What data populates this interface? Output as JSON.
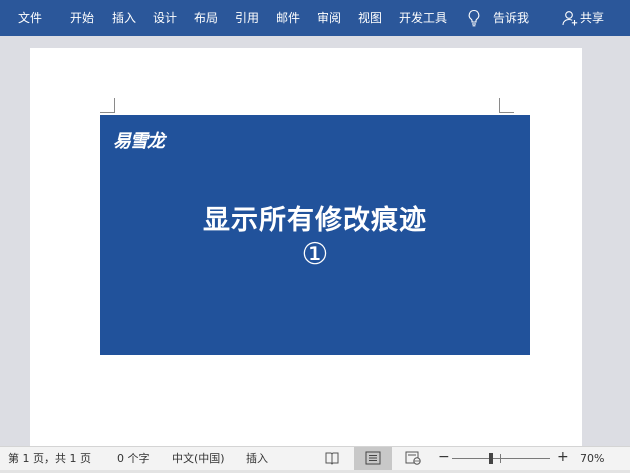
{
  "ribbon": {
    "tabs": [
      "文件",
      "开始",
      "插入",
      "设计",
      "布局",
      "引用",
      "邮件",
      "审阅",
      "视图",
      "开发工具"
    ],
    "tell_me": "告诉我",
    "share": "共享",
    "background": "#2b579a"
  },
  "document": {
    "banner": {
      "brand": "易雪龙",
      "headline": "显示所有修改痕迹",
      "step": "①",
      "background": "#21529b"
    }
  },
  "status_bar": {
    "page_info": "第 1 页，共 1 页",
    "word_count": "0 个字",
    "language": "中文(中国)",
    "insert_mode": "插入",
    "zoom_level": "70%",
    "zoom_fraction": 0.4,
    "active_view": "print-layout"
  }
}
